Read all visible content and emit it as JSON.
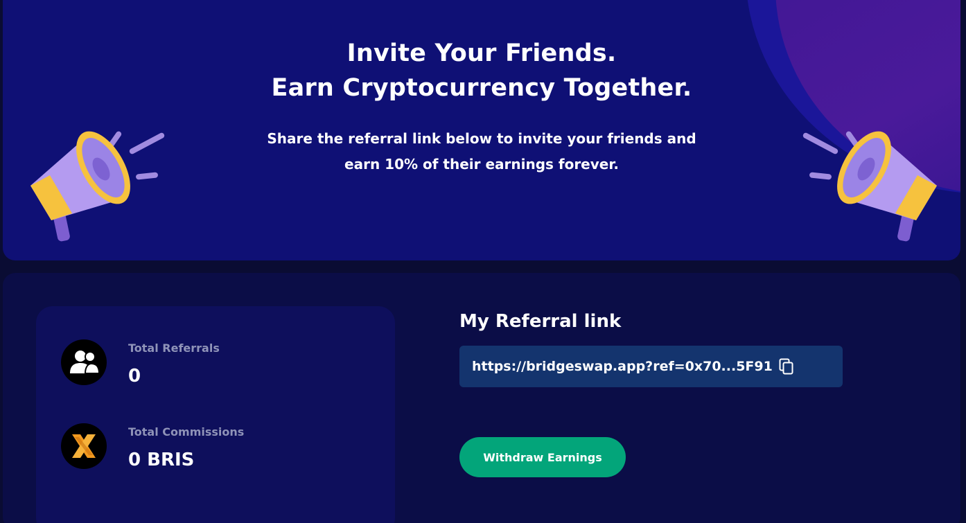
{
  "hero": {
    "title_line1": "Invite Your Friends.",
    "title_line2": "Earn Cryptocurrency Together.",
    "subtitle_line1": "Share the referral link below to invite your friends and",
    "subtitle_line2": "earn 10% of their earnings forever."
  },
  "stats": [
    {
      "label": "Total Referrals",
      "value": "0",
      "icon": "users-icon"
    },
    {
      "label": "Total Commissions",
      "value": "0 BRIS",
      "icon": "bris-logo-icon"
    }
  ],
  "referral": {
    "title": "My Referral link",
    "link": "https://bridgeswap.app?ref=0x70...5F91",
    "copy_icon": "copy-icon"
  },
  "actions": {
    "withdraw_label": "Withdraw Earnings"
  },
  "colors": {
    "hero_bg": "#0f1075",
    "page_bg": "#0a0c33",
    "link_box": "#14346e",
    "withdraw_button": "#03a57a",
    "muted_label": "#8f93b8"
  }
}
